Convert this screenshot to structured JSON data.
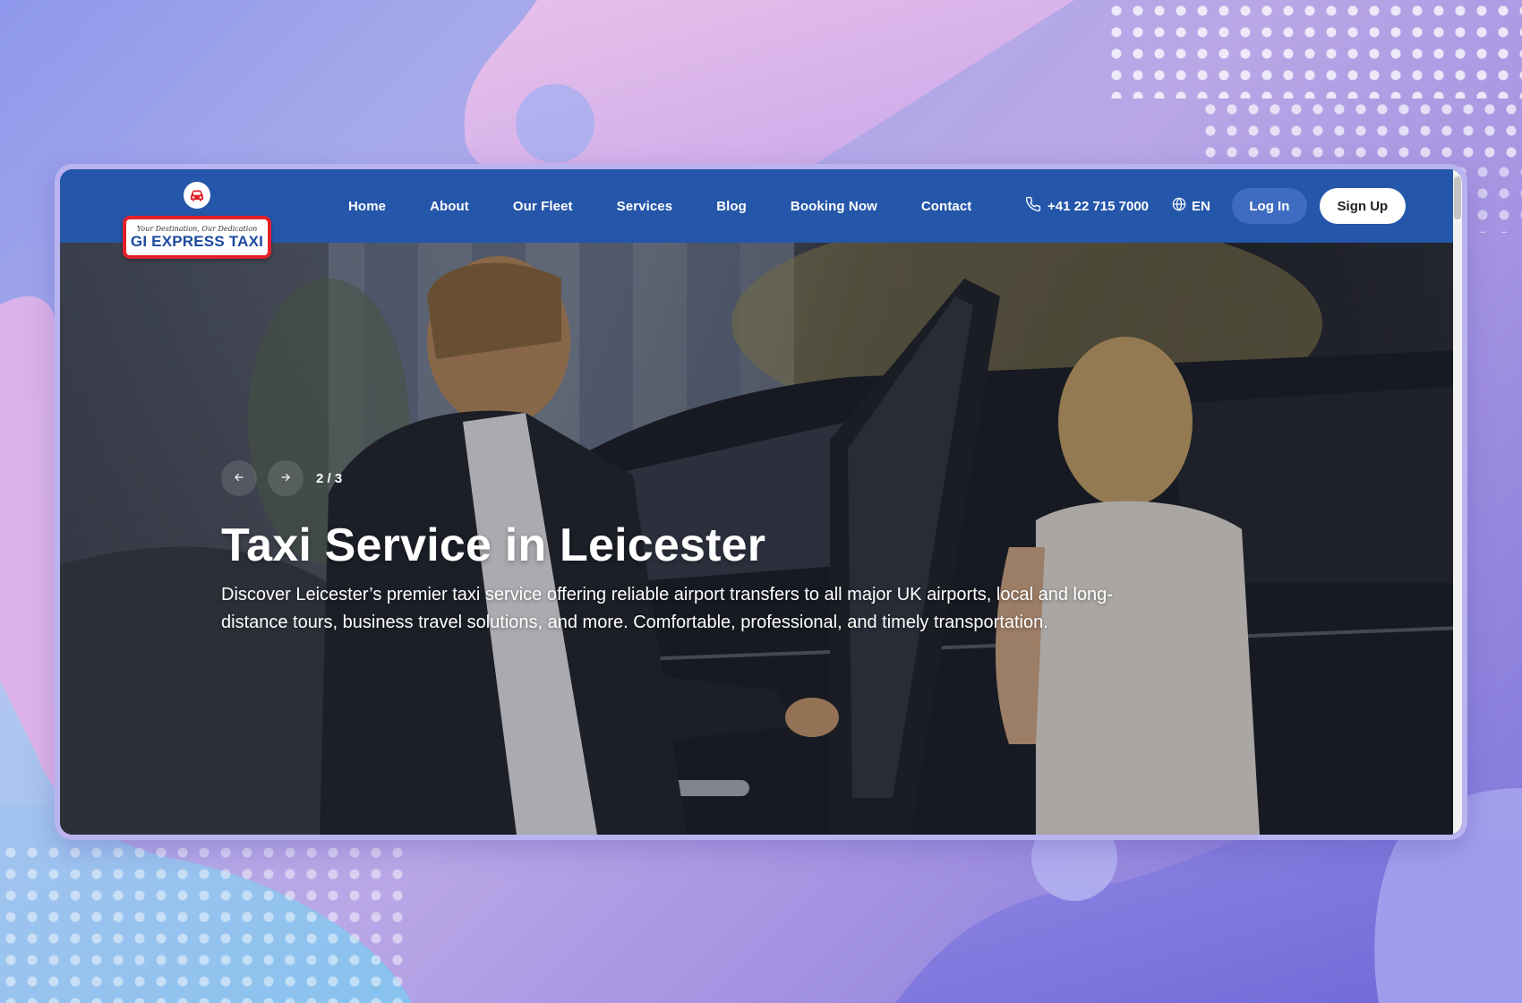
{
  "brand": {
    "tagline": "Your Destination, Our Dedication",
    "name": "GI EXPRESS TAXI"
  },
  "nav": {
    "items": [
      {
        "label": "Home"
      },
      {
        "label": "About"
      },
      {
        "label": "Our Fleet"
      },
      {
        "label": "Services"
      },
      {
        "label": "Blog"
      },
      {
        "label": "Booking Now"
      },
      {
        "label": "Contact"
      }
    ]
  },
  "header": {
    "phone": "+41 22 715 7000",
    "language": "EN",
    "login_label": "Log In",
    "signup_label": "Sign Up"
  },
  "hero": {
    "slide_counter": "2 / 3",
    "prev_icon": "arrow-left-icon",
    "next_icon": "arrow-right-icon",
    "title": "Taxi Service in Leicester",
    "description": "Discover Leicester’s premier taxi service offering reliable airport transfers to all major UK airports, local and long-distance tours, business travel solutions, and more. Comfortable, professional, and timely transportation."
  },
  "colors": {
    "header_bg": "#2456a9",
    "logo_border": "#e1212a",
    "login_bg": "#3f6bc0",
    "signup_bg": "#ffffff"
  }
}
